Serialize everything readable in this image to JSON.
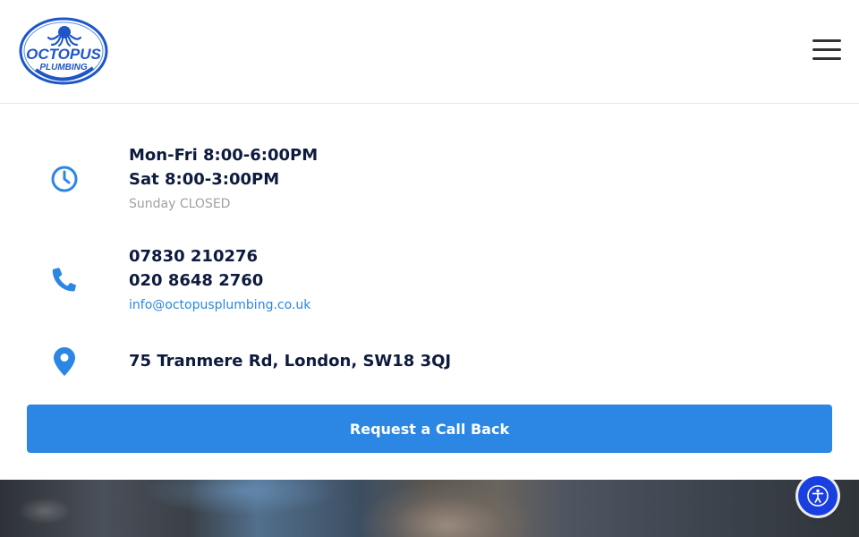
{
  "header": {
    "logo_alt": "Octopus Plumbing",
    "logo_text_top": "OCTOPUS",
    "logo_text_bottom": "PLUMBING"
  },
  "contact": {
    "hours": {
      "icon": "clock-icon",
      "weekday": "Mon-Fri 8:00-6:00PM",
      "saturday": "Sat 8:00-3:00PM",
      "sunday": "Sunday CLOSED"
    },
    "phone": {
      "icon": "phone-icon",
      "mobile": "07830 210276",
      "landline": "020 8648 2760",
      "email": "info@octopusplumbing.co.uk"
    },
    "address": {
      "icon": "map-pin-icon",
      "text": "75 Tranmere Rd, London, SW18 3QJ"
    }
  },
  "cta": {
    "label": "Request a Call Back"
  },
  "accessibility": {
    "icon": "accessibility-icon"
  },
  "colors": {
    "accent": "#2b87e3",
    "text_dark": "#0d1b3e",
    "text_muted": "#a0a0a0",
    "a11y_button": "#1a3fe0"
  }
}
